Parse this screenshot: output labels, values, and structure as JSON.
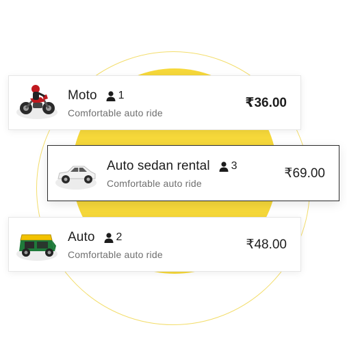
{
  "rides": [
    {
      "title": "Moto",
      "seats": "1",
      "subtitle": "Comfortable auto ride",
      "price": "₹36.00",
      "icon": "motorcycle-icon",
      "selected": false
    },
    {
      "title": "Auto sedan rental",
      "seats": "3",
      "subtitle": "Comfortable auto ride",
      "price": "₹69.00",
      "icon": "sedan-car-icon",
      "selected": true
    },
    {
      "title": "Auto",
      "seats": "2",
      "subtitle": "Comfortable auto ride",
      "price": "₹48.00",
      "icon": "auto-rickshaw-icon",
      "selected": false
    }
  ],
  "colors": {
    "accent_yellow": "#f6d83a",
    "ring": "#f3dd6a",
    "text_primary": "#1d1d1d",
    "text_secondary": "#6e6e6e",
    "selected_border": "#2a2a2a"
  }
}
